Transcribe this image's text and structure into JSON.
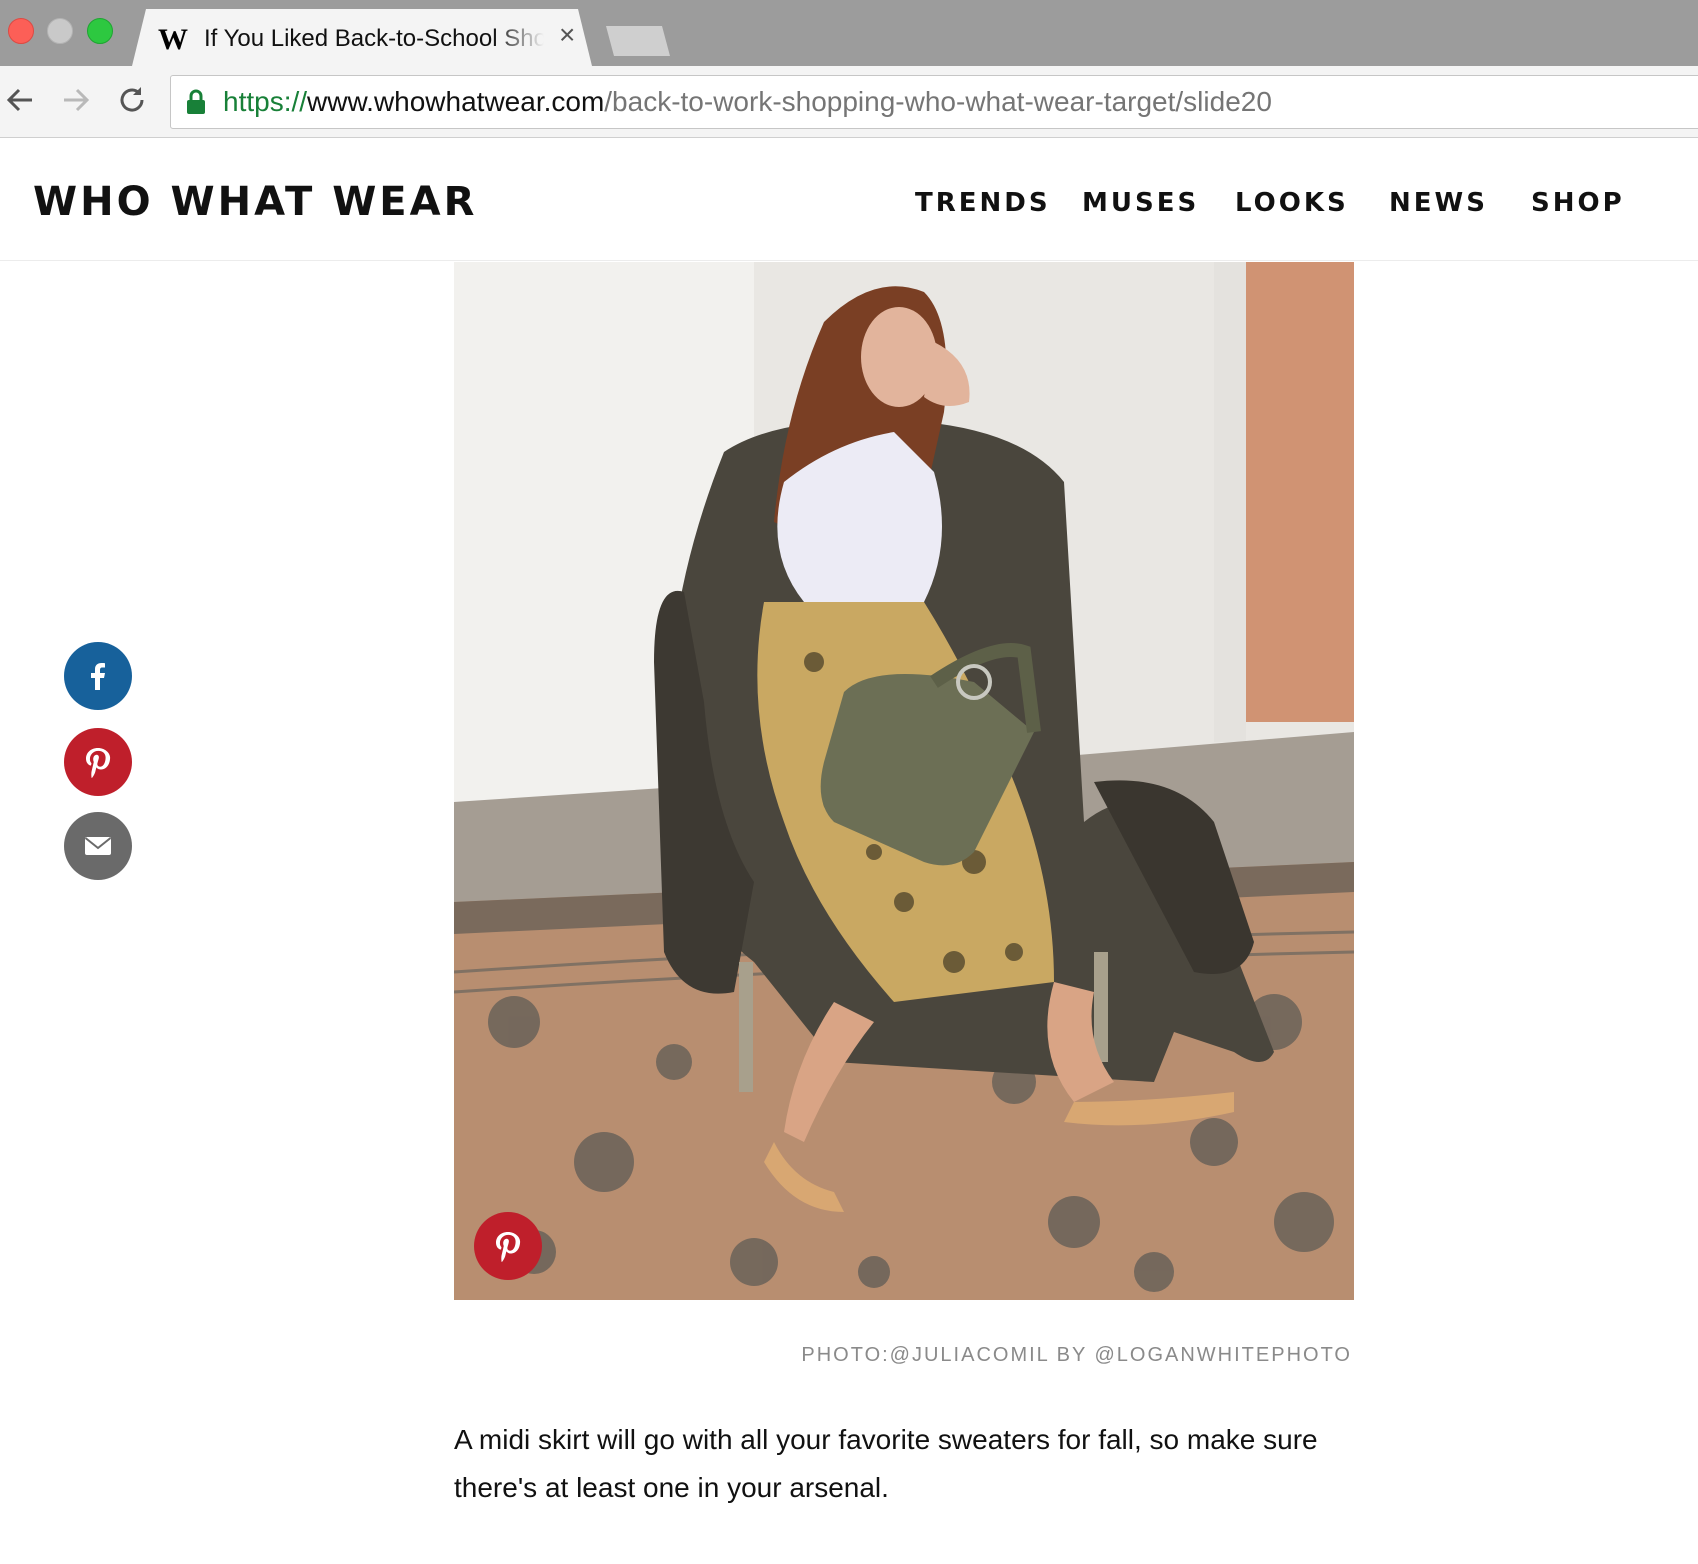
{
  "browser": {
    "tab": {
      "favicon": "W",
      "title": "If You Liked Back-to-School Shopping",
      "close": "×"
    },
    "url": {
      "scheme": "https://",
      "host": "www.whowhatwear.com",
      "path": "/back-to-work-shopping-who-what-wear-target/slide20"
    },
    "icons": [
      "back-icon",
      "forward-icon",
      "reload-icon",
      "lock-icon"
    ]
  },
  "site": {
    "logo": "WHO WHAT WEAR",
    "nav": [
      "TRENDS",
      "MUSES",
      "LOOKS",
      "NEWS",
      "SHOP"
    ]
  },
  "share": {
    "icons": [
      "facebook-icon",
      "pinterest-icon",
      "email-icon"
    ]
  },
  "article": {
    "photo_credit": "PHOTO:@JULIACOMIL BY @LOGANWHITEPHOTO",
    "body": "A midi skirt will go with all your favorite sweaters for fall, so make sure there's at least one in your arsenal."
  },
  "colors": {
    "facebook": "#17619b",
    "pinterest": "#bf1f2b",
    "email": "#6a6a6a",
    "secure_green": "#188038"
  }
}
